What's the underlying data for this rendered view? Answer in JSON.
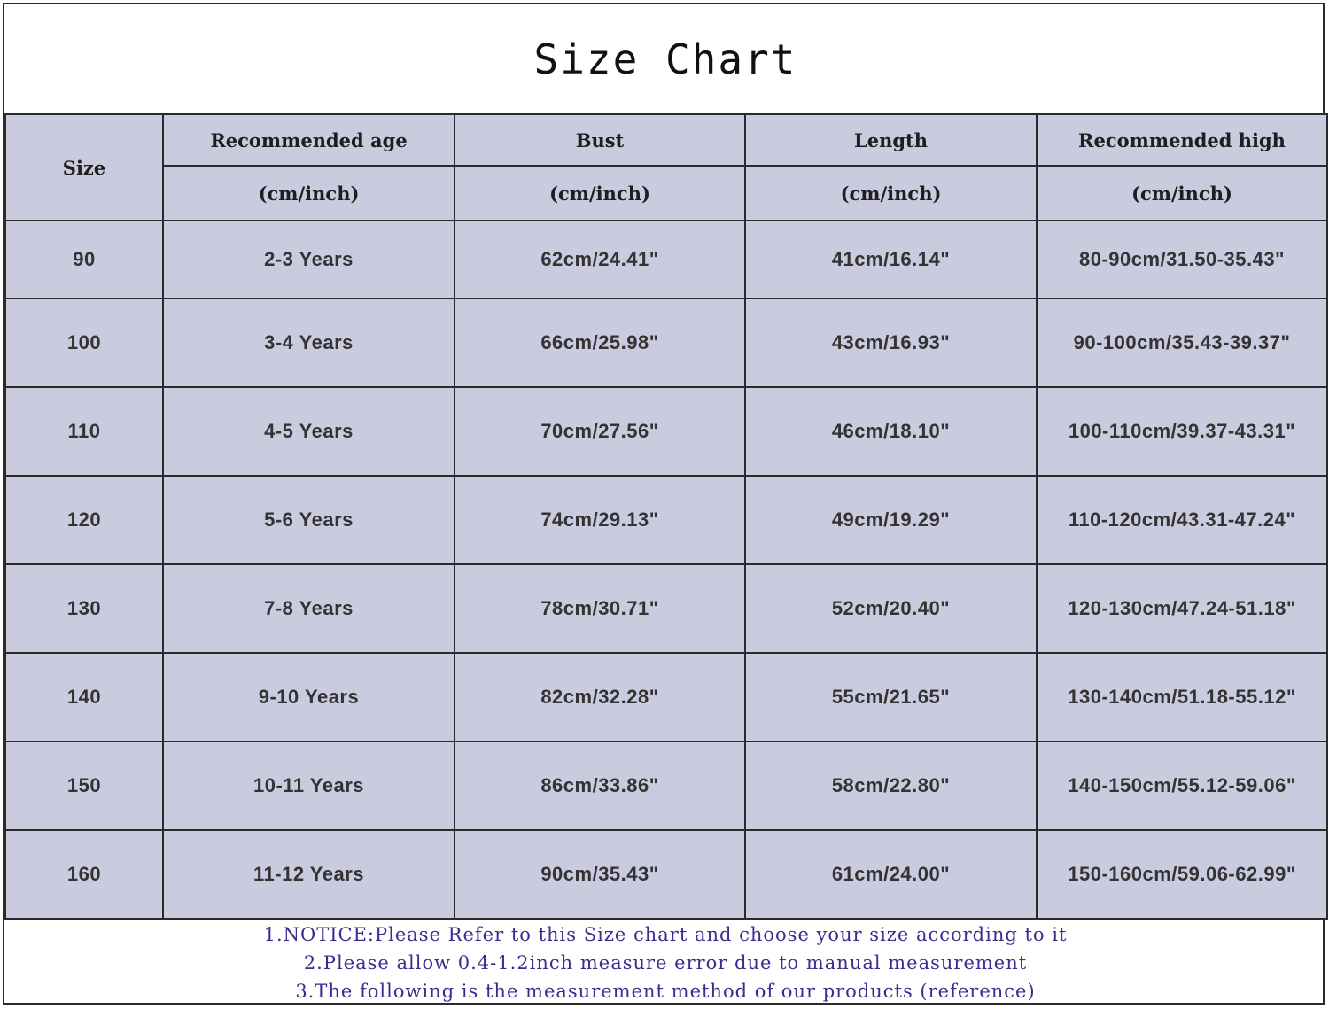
{
  "title": "Size Chart",
  "columns": {
    "size": "Size",
    "age": "Recommended age",
    "bust": "Bust",
    "length": "Length",
    "high": "Recommended high",
    "unit": "(cm/inch)"
  },
  "rows": [
    {
      "size": "90",
      "age": "2-3 Years",
      "bust": "62cm/24.41\"",
      "length": "41cm/16.14\"",
      "high": "80-90cm/31.50-35.43\""
    },
    {
      "size": "100",
      "age": "3-4 Years",
      "bust": "66cm/25.98\"",
      "length": "43cm/16.93\"",
      "high": "90-100cm/35.43-39.37\""
    },
    {
      "size": "110",
      "age": "4-5 Years",
      "bust": "70cm/27.56\"",
      "length": "46cm/18.10\"",
      "high": "100-110cm/39.37-43.31\""
    },
    {
      "size": "120",
      "age": "5-6 Years",
      "bust": "74cm/29.13\"",
      "length": "49cm/19.29\"",
      "high": "110-120cm/43.31-47.24\""
    },
    {
      "size": "130",
      "age": "7-8 Years",
      "bust": "78cm/30.71\"",
      "length": "52cm/20.40\"",
      "high": "120-130cm/47.24-51.18\""
    },
    {
      "size": "140",
      "age": "9-10 Years",
      "bust": "82cm/32.28\"",
      "length": "55cm/21.65\"",
      "high": "130-140cm/51.18-55.12\""
    },
    {
      "size": "150",
      "age": "10-11 Years",
      "bust": "86cm/33.86\"",
      "length": "58cm/22.80\"",
      "high": "140-150cm/55.12-59.06\""
    },
    {
      "size": "160",
      "age": "11-12 Years",
      "bust": "90cm/35.43\"",
      "length": "61cm/24.00\"",
      "high": "150-160cm/59.06-62.99\""
    }
  ],
  "notes": [
    "1.NOTICE:Please Refer to this Size chart and choose your size according to it",
    "2.Please allow 0.4-1.2inch measure error due to manual measurement",
    "3.The following is the measurement method of our products (reference)"
  ],
  "colors": {
    "table_fill": "#cbcbe0",
    "border": "#2b2b2b",
    "note_text": "#3b2d8f"
  }
}
